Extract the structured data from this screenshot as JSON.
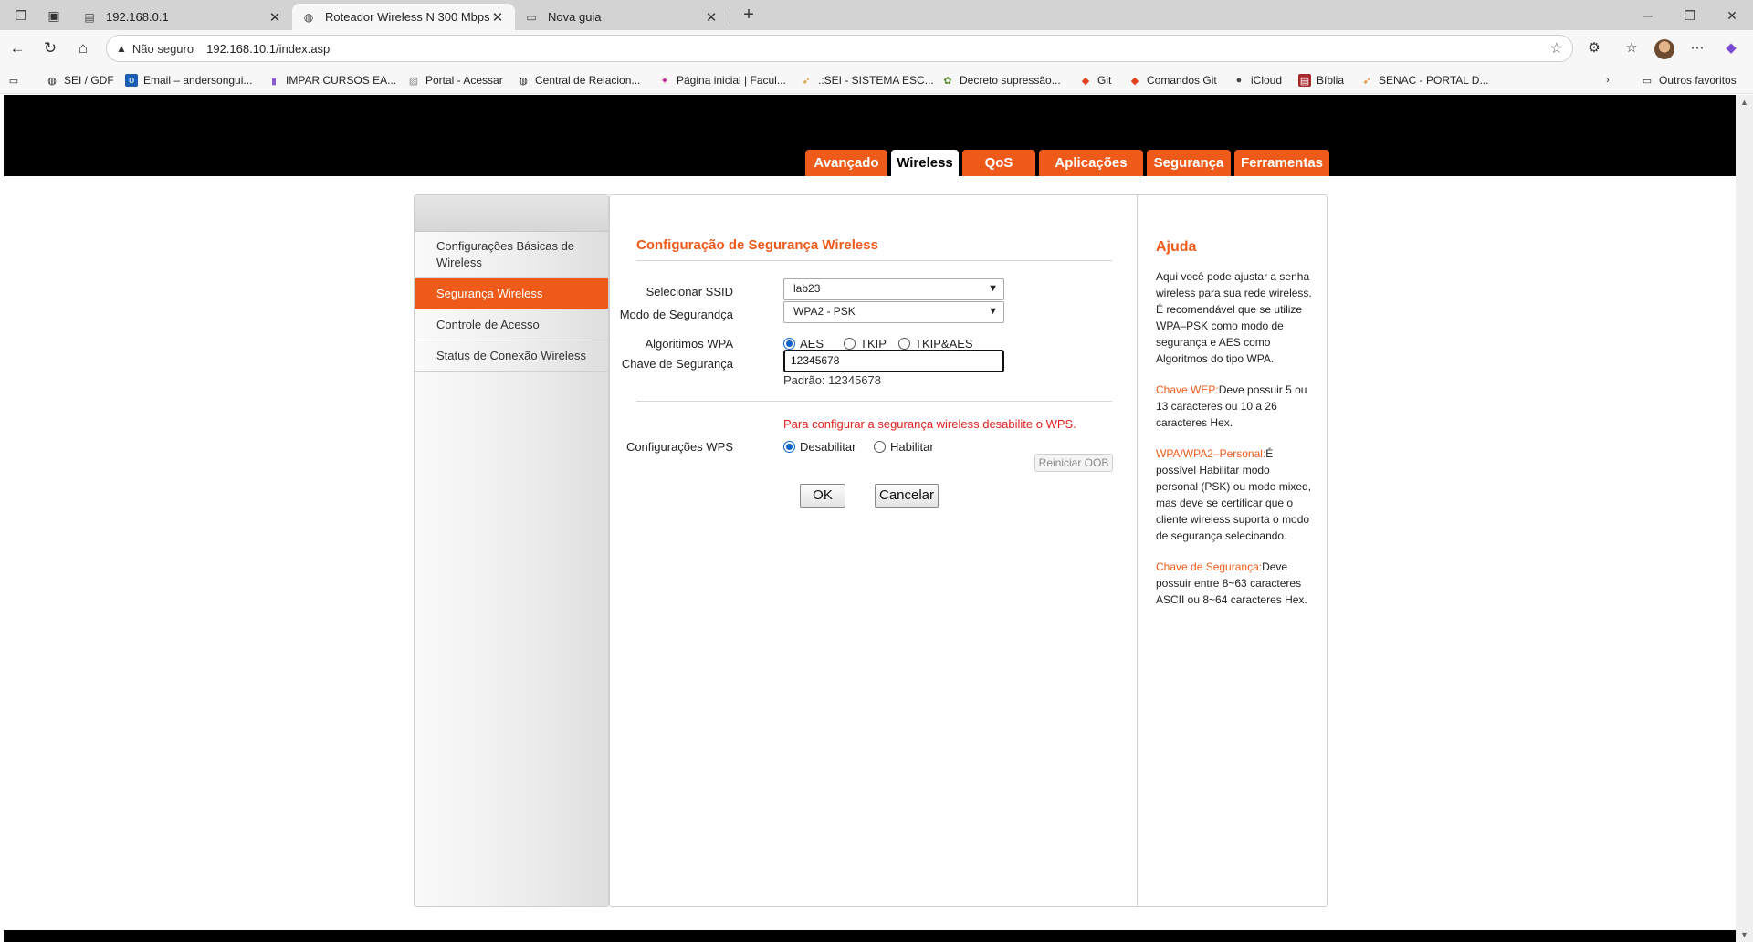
{
  "browser": {
    "tabs": [
      {
        "title": "192.168.0.1",
        "icon": "page-icon",
        "active": false
      },
      {
        "title": "Roteador Wireless N 300 Mbps",
        "icon": "globe-icon",
        "active": true
      },
      {
        "title": "Nova guia",
        "icon": "newtab-icon",
        "active": false
      }
    ],
    "new_tab_label": "+",
    "security_label": "Não seguro",
    "url": "192.168.10.1/index.asp",
    "bookmarks": [
      {
        "label": "SEI / GDF",
        "icon": "globe-icon"
      },
      {
        "label": "Email – andersongui...",
        "icon": "outlook-icon"
      },
      {
        "label": "IMPAR CURSOS EA...",
        "icon": "impar-icon"
      },
      {
        "label": "Portal - Acessar",
        "icon": "portal-icon"
      },
      {
        "label": "Central de Relacion...",
        "icon": "globe-icon"
      },
      {
        "label": "Página inicial | Facul...",
        "icon": "faculdade-icon"
      },
      {
        "label": ".:SEI - SISTEMA ESC...",
        "icon": "sei-icon"
      },
      {
        "label": "Decreto supressão...",
        "icon": "decreto-icon"
      },
      {
        "label": "Git",
        "icon": "git-icon"
      },
      {
        "label": "Comandos Git",
        "icon": "git-icon"
      },
      {
        "label": "iCloud",
        "icon": "apple-icon"
      },
      {
        "label": "Bíblia",
        "icon": "bible-icon"
      },
      {
        "label": "SENAC - PORTAL D...",
        "icon": "senac-icon"
      }
    ],
    "other_favorites": "Outros favoritos"
  },
  "router": {
    "nav_tabs": [
      "Avançado",
      "Wireless",
      "QoS",
      "Aplicações",
      "Segurança",
      "Ferramentas"
    ],
    "active_nav": "Wireless",
    "sidebar": [
      {
        "label": "Configurações Básicas de Wireless",
        "active": false
      },
      {
        "label": "Segurança Wireless",
        "active": true
      },
      {
        "label": "Controle de Acesso",
        "active": false
      },
      {
        "label": "Status de Conexão Wireless",
        "active": false
      }
    ],
    "form": {
      "title": "Configuração de Segurança Wireless",
      "ssid_label": "Selecionar SSID",
      "ssid_value": "lab23",
      "mode_label": "Modo de Segurandça",
      "mode_value": "WPA2 - PSK",
      "wpa_label": "Algoritimos WPA",
      "wpa_options": [
        "AES",
        "TKIP",
        "TKIP&AES"
      ],
      "wpa_selected": "AES",
      "key_label": "Chave de Segurança",
      "key_value": "12345678",
      "default_note": "Padrão: 12345678",
      "wps_note": "Para configurar a segurança wireless,desabilite o WPS.",
      "wps_label": "Configurações WPS",
      "wps_options": [
        "Desabilitar",
        "Habilitar"
      ],
      "wps_selected": "Desabilitar",
      "reset_oob": "Reiniciar OOB",
      "ok": "OK",
      "cancel": "Cancelar"
    },
    "help": {
      "title": "Ajuda",
      "intro": "Aqui você pode ajustar a senha wireless para sua rede wireless. É recomendável que se utilize WPA–PSK como modo de segurança e AES como Algoritmos do tipo WPA.",
      "wep_term": "Chave WEP:",
      "wep_text": "Deve possuir 5 ou 13 caracteres ou 10 a 26 caracteres Hex.",
      "wpa_term": "WPA/WPA2–Personal:",
      "wpa_text": "É possível Habilitar modo personal (PSK) ou modo mixed, mas deve se certificar que o cliente wireless suporta o modo de segurança selecioando.",
      "key_term": "Chave de Segurança:",
      "key_text": "Deve possuir entre 8~63 caracteres ASCII ou 8~64 caracteres Hex."
    }
  },
  "colors": {
    "accent": "#ee5a1a",
    "header": "#000000",
    "warning": "#e0201d"
  }
}
